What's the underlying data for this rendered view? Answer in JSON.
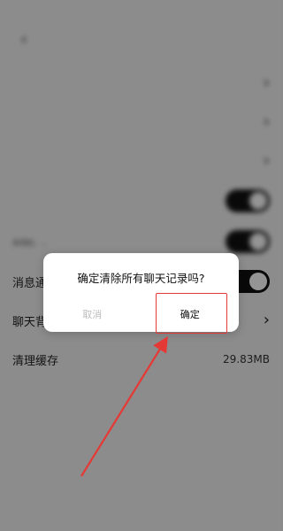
{
  "statusbar": {
    "left": "",
    "center": "",
    "right": ""
  },
  "header": {
    "title": ""
  },
  "rows": [
    {
      "label": "",
      "sub": "",
      "right_text": "",
      "kind": "chevron"
    },
    {
      "label": "",
      "sub": "",
      "right_text": "",
      "kind": "chevron"
    },
    {
      "label": "",
      "sub": "",
      "right_text": "",
      "kind": "chevron"
    },
    {
      "label": "",
      "sub": "",
      "right_text": "",
      "kind": "toggle"
    },
    {
      "label": "",
      "sub": "关闭后，...",
      "right_text": "",
      "kind": "toggle"
    },
    {
      "label": "消息通",
      "sub": "",
      "right_text": "",
      "kind": "toggle"
    },
    {
      "label": "聊天背",
      "sub": "",
      "right_text": "",
      "kind": "chevron"
    },
    {
      "label": "清理缓存",
      "sub": "",
      "right_text": "29.83MB",
      "kind": "value"
    },
    {
      "label": "",
      "sub": "",
      "right_text": "",
      "kind": "text"
    },
    {
      "label": "",
      "sub": "",
      "right_text": "",
      "kind": "text"
    },
    {
      "label": "",
      "sub": "",
      "right_text": "",
      "kind": "danger"
    }
  ],
  "dialog": {
    "message": "确定清除所有聊天记录吗?",
    "cancel_label": "取消",
    "ok_label": "确定"
  },
  "colors": {
    "highlight": "#e53935",
    "overlay": "rgba(0,0,0,0.42)"
  }
}
